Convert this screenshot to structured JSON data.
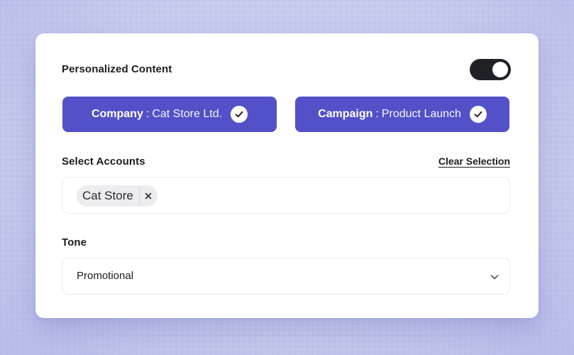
{
  "personalized": {
    "label": "Personalized Content",
    "enabled": true
  },
  "chips": [
    {
      "key": "Company",
      "separator": ":",
      "value": "Cat Store Ltd.",
      "checked": true
    },
    {
      "key": "Campaign",
      "separator": ":",
      "value": "Product Launch",
      "checked": true
    }
  ],
  "accounts": {
    "label": "Select Accounts",
    "clear_label": "Clear Selection",
    "selected": [
      {
        "label": "Cat Store",
        "remove_symbol": "×"
      }
    ]
  },
  "tone": {
    "label": "Tone",
    "value": "Promotional"
  },
  "colors": {
    "accent": "#5350c8",
    "toggle_on": "#1f2127",
    "card": "#ffffff",
    "background": "#c9cdee"
  },
  "icons": {
    "chip_check": "check-icon",
    "tag_remove": "close-icon",
    "select": "chevron-down-icon"
  }
}
